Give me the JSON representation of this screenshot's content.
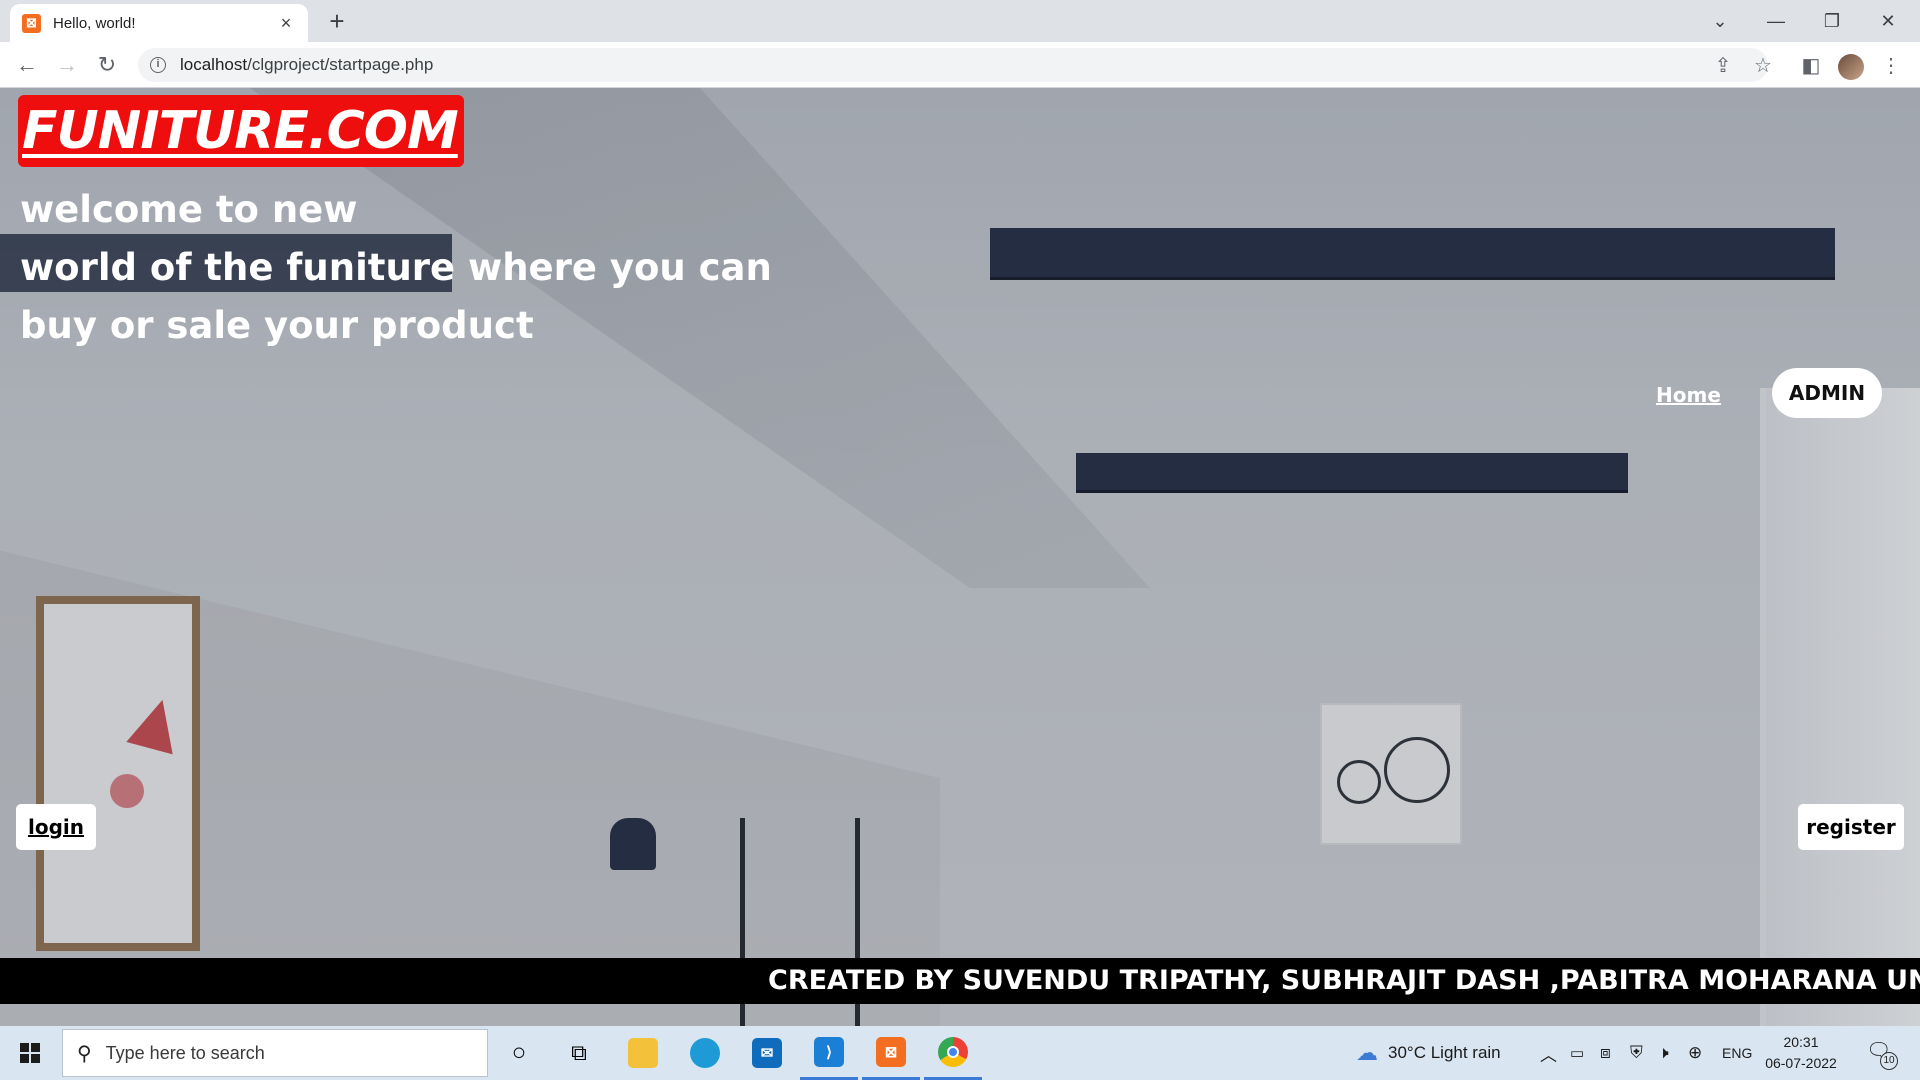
{
  "browser": {
    "tab_title": "Hello, world!",
    "tab_close": "×",
    "new_tab": "+",
    "url_host": "localhost",
    "url_path": "/clgproject/startpage.php",
    "window_controls": {
      "dropdown": "⌄",
      "minimize": "—",
      "restore": "❐",
      "close": "✕"
    },
    "nav": {
      "back": "←",
      "forward": "→",
      "reload": "↻"
    }
  },
  "page": {
    "brand": "FUNITURE.COM",
    "tagline": [
      "welcome to new",
      "world of the funiture where you can",
      "buy or sale your product"
    ],
    "nav_home": "Home",
    "nav_admin": "ADMIN",
    "login_label": "login",
    "register_label": "register",
    "marquee_text": "CREATED BY SUVENDU TRIPATHY, SUBHRAJIT DASH ,PABITRA MOHARANA UNDER"
  },
  "taskbar": {
    "search_placeholder": "Type here to search",
    "weather": "30°C  Light rain",
    "language": "ENG",
    "time": "20:31",
    "date": "06-07-2022",
    "notifications": "10"
  },
  "colors": {
    "brand_red": "#ee0e0e",
    "marquee_bg": "#000000",
    "taskbar_bg": "#d9e6f2"
  }
}
